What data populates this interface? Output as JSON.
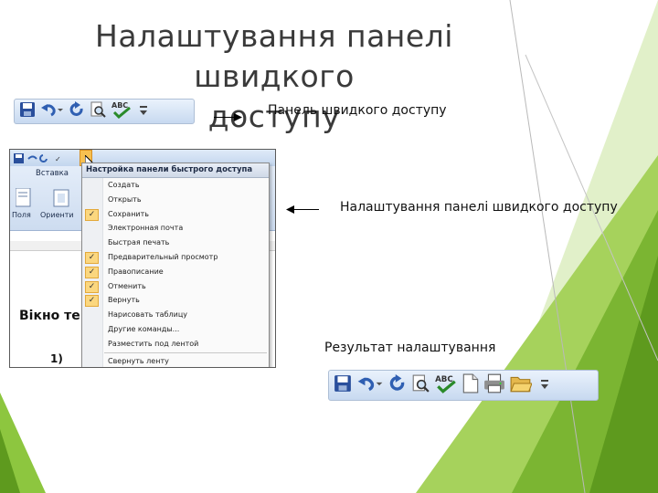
{
  "slide": {
    "title_line1": "Налаштування панелі швидкого",
    "title_line2": "доступу",
    "caption_qat": "Панель швидкого доступу",
    "caption_customize": "Налаштування панелі швидкого доступу",
    "caption_result": "Результат  налаштування",
    "label_1": "1)"
  },
  "word_screenshot": {
    "ribbon_tab": "Вставка",
    "ribbon_left_labels": [
      "Поля",
      "Ориенти"
    ],
    "body_text": "Вікно те",
    "menu": {
      "header": "Настройка панели быстрого доступа",
      "items": [
        {
          "label": "Создать",
          "checked": false
        },
        {
          "label": "Открыть",
          "checked": false
        },
        {
          "label": "Сохранить",
          "checked": true
        },
        {
          "label": "Электронная почта",
          "checked": false
        },
        {
          "label": "Быстрая печать",
          "checked": false
        },
        {
          "label": "Предварительный просмотр",
          "checked": true
        },
        {
          "label": "Правописание",
          "checked": true
        },
        {
          "label": "Отменить",
          "checked": true
        },
        {
          "label": "Вернуть",
          "checked": true
        },
        {
          "label": "Нарисовать таблицу",
          "checked": false
        },
        {
          "label": "Другие команды...",
          "checked": false
        },
        {
          "label": "Разместить под лентой",
          "checked": false
        },
        {
          "label": "Свернуть ленту",
          "checked": false
        }
      ]
    }
  },
  "icons": {
    "toolbar_original": [
      "save-icon",
      "undo-icon",
      "redo-icon",
      "print-preview-icon",
      "spelling-icon",
      "customize-dropdown-icon"
    ],
    "toolbar_result": [
      "save-icon",
      "undo-icon",
      "redo-icon",
      "print-preview-icon",
      "spelling-icon",
      "new-document-icon",
      "quick-print-icon",
      "open-folder-icon",
      "customize-dropdown-icon"
    ]
  },
  "colors": {
    "accent_green": "#8dc63f",
    "accent_dark_green": "#5e9a1e",
    "title": "#3a3a3a",
    "toolbar_bg": "#d6e4f5",
    "menu_check": "#fbd77f"
  }
}
